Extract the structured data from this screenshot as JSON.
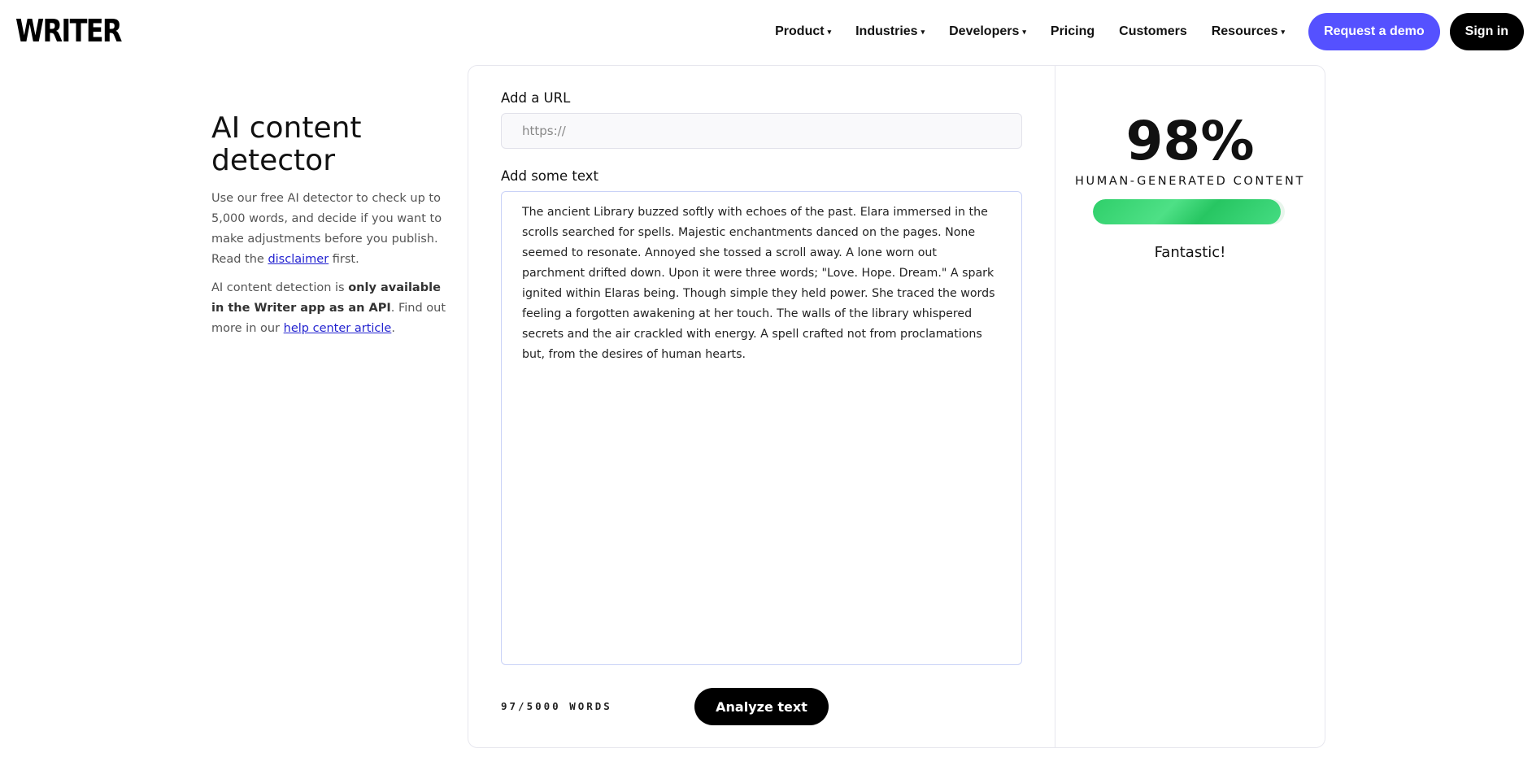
{
  "header": {
    "logo": "WRITER",
    "nav": [
      {
        "label": "Product",
        "dropdown": true
      },
      {
        "label": "Industries",
        "dropdown": true
      },
      {
        "label": "Developers",
        "dropdown": true
      },
      {
        "label": "Pricing",
        "dropdown": false
      },
      {
        "label": "Customers",
        "dropdown": false
      },
      {
        "label": "Resources",
        "dropdown": true
      }
    ],
    "demo_button": "Request a demo",
    "signin_button": "Sign in",
    "caret": "▾"
  },
  "intro": {
    "title": "AI content detector",
    "p1_text": "Use our free AI detector to check up to 5,000 words, and decide if you want to make adjustments before you publish. Read the ",
    "p1_link": "disclaimer",
    "p1_after": " first.",
    "p2_before": "AI content detection is ",
    "p2_bold": "only available in the Writer app as an API",
    "p2_mid": ". Find out more in our ",
    "p2_link": "help center article",
    "p2_after": "."
  },
  "form": {
    "url_label": "Add a URL",
    "url_placeholder": "https://",
    "url_value": "",
    "text_label": "Add some text",
    "text_value": "The ancient Library buzzed softly with echoes of the past. Elara immersed in the scrolls searched for spells. Majestic enchantments danced on the pages. None seemed to resonate. Annoyed she tossed a scroll away. A lone worn out parchment drifted down. Upon it were three words; \"Love. Hope. Dream.\" A spark ignited within Elaras being. Though simple they held power. She traced the words feeling a forgotten awakening at her touch. The walls of the library whispered secrets and the air crackled with energy. A spell crafted not from proclamations but, from the desires of human hearts.",
    "word_count": "97/5000 WORDS",
    "analyze_button": "Analyze text"
  },
  "result": {
    "score": "98%",
    "score_fraction": 0.98,
    "label": "HUMAN-GENERATED CONTENT",
    "verdict": "Fantastic!",
    "bar_color": "#2fcf6a"
  }
}
